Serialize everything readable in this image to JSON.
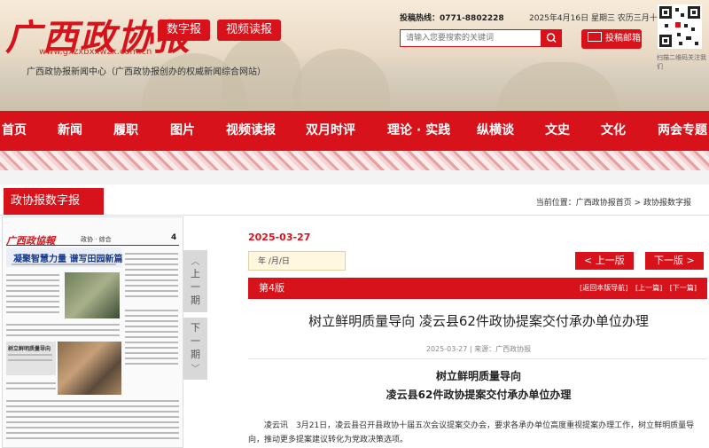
{
  "header": {
    "logo_text": "广西政协报",
    "url": "www.gxzxbxxwzx.com.cn",
    "tagline": "广西政协报新闻中心（广西政协报创办的权威新闻综合网站）",
    "buttons": [
      "数字报",
      "视频读报"
    ],
    "hotline_label": "投稿热线：",
    "hotline_number": "0771-8802228",
    "date": "2025年4月16日 星期三 农历三月十九",
    "search_placeholder": "请输入您要搜索的关键词",
    "mail_label": "投稿邮箱",
    "qr_caption": "扫描二维码关注我们"
  },
  "nav": {
    "items": [
      "首页",
      "新闻",
      "履职",
      "图片",
      "视频读报",
      "双月时评",
      "理论 · 实践",
      "纵横谈",
      "文史",
      "文化",
      "两会专题"
    ]
  },
  "section": {
    "title": "政协报数字报",
    "breadcrumb": "当前位置：广西政协报首页 > 政协报数字报"
  },
  "paper": {
    "masthead": "广西政協報",
    "section_label": "政协 · 综合",
    "page_number": "4",
    "headline": "凝聚智慧力量  谱写田园新篇",
    "sub_headline": "树立鲜明质量导向"
  },
  "page_turn": {
    "prev": [
      "上",
      "一",
      "期"
    ],
    "next": [
      "下",
      "一",
      "期"
    ]
  },
  "edition": {
    "pub_date": "2025-03-27",
    "date_input": "年  /月/日",
    "prev_label": "< 上一版",
    "next_label": "下一版 >",
    "edition_no": "第4版",
    "links": [
      "[返回本版导航]",
      "[上一篇]",
      "[下一篇]"
    ]
  },
  "article": {
    "title": "树立鲜明质量导向 凌云县62件政协提案交付承办单位办理",
    "meta": "2025-03-27 | 来源：广西政协报",
    "heading1": "树立鲜明质量导向",
    "heading2": "凌云县62件政协提案交付承办单位办理",
    "body": "凌云讯　3月21日，凌云县召开县政协十届五次会议提案交办会，要求各承办单位高度重视提案办理工作，树立鲜明质量导向，推动更多提案建议转化为党政决策选项。"
  },
  "colors": {
    "brand_red": "#d7121a",
    "date_bg": "#fff7df"
  }
}
